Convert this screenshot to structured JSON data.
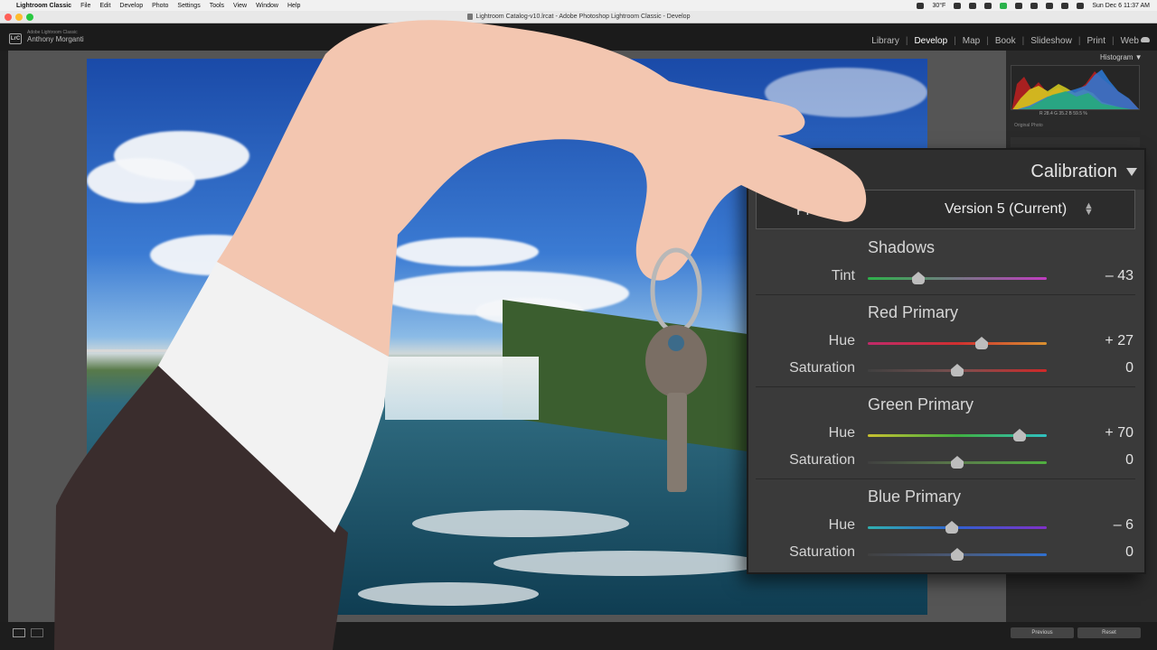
{
  "menubar": {
    "app_name": "Lightroom Classic",
    "menus": [
      "File",
      "Edit",
      "Develop",
      "Photo",
      "Settings",
      "Tools",
      "View",
      "Window",
      "Help"
    ],
    "temperature": "30°F",
    "datetime": "Sun Dec 6  11:37 AM"
  },
  "window": {
    "title": "Lightroom Catalog-v10.lrcat - Adobe Photoshop Lightroom Classic - Develop"
  },
  "lightroom": {
    "logo": "LrC",
    "product": "Adobe Lightroom Classic",
    "user": "Anthony Morganti",
    "modules": [
      "Library",
      "Develop",
      "Map",
      "Book",
      "Slideshow",
      "Print",
      "Web"
    ],
    "active_module": "Develop"
  },
  "histogram": {
    "label": "Histogram ▼",
    "r_label": "R",
    "r_value": "28.4",
    "g_label": "G",
    "g_value": "35.2",
    "b_label": "B",
    "b_value": "59.5 %",
    "original_photo": "Original Photo"
  },
  "calibration": {
    "title": "Calibration",
    "process_label": "Pr",
    "process_value": "Version 5 (Current)",
    "sections": [
      {
        "title": "Shadows",
        "rows": [
          {
            "label": "Tint",
            "value": "– 43",
            "level": -43
          }
        ]
      },
      {
        "title": "Red Primary",
        "rows": [
          {
            "label": "Hue",
            "value": "+ 27",
            "level": 27
          },
          {
            "label": "Saturation",
            "value": "0",
            "level": 0
          }
        ]
      },
      {
        "title": "Green Primary",
        "rows": [
          {
            "label": "Hue",
            "value": "+ 70",
            "level": 70
          },
          {
            "label": "Saturation",
            "value": "0",
            "level": 0
          }
        ]
      },
      {
        "title": "Blue Primary",
        "rows": [
          {
            "label": "Hue",
            "value": "– 6",
            "level": -6
          },
          {
            "label": "Saturation",
            "value": "0",
            "level": 0
          }
        ]
      }
    ]
  },
  "bottom_bar": {
    "previous_label": "Previous",
    "reset_label": "Reset"
  },
  "colors": {
    "panel_bg": "#3a3a3a",
    "slider_thumb": "#bdbdbd"
  }
}
